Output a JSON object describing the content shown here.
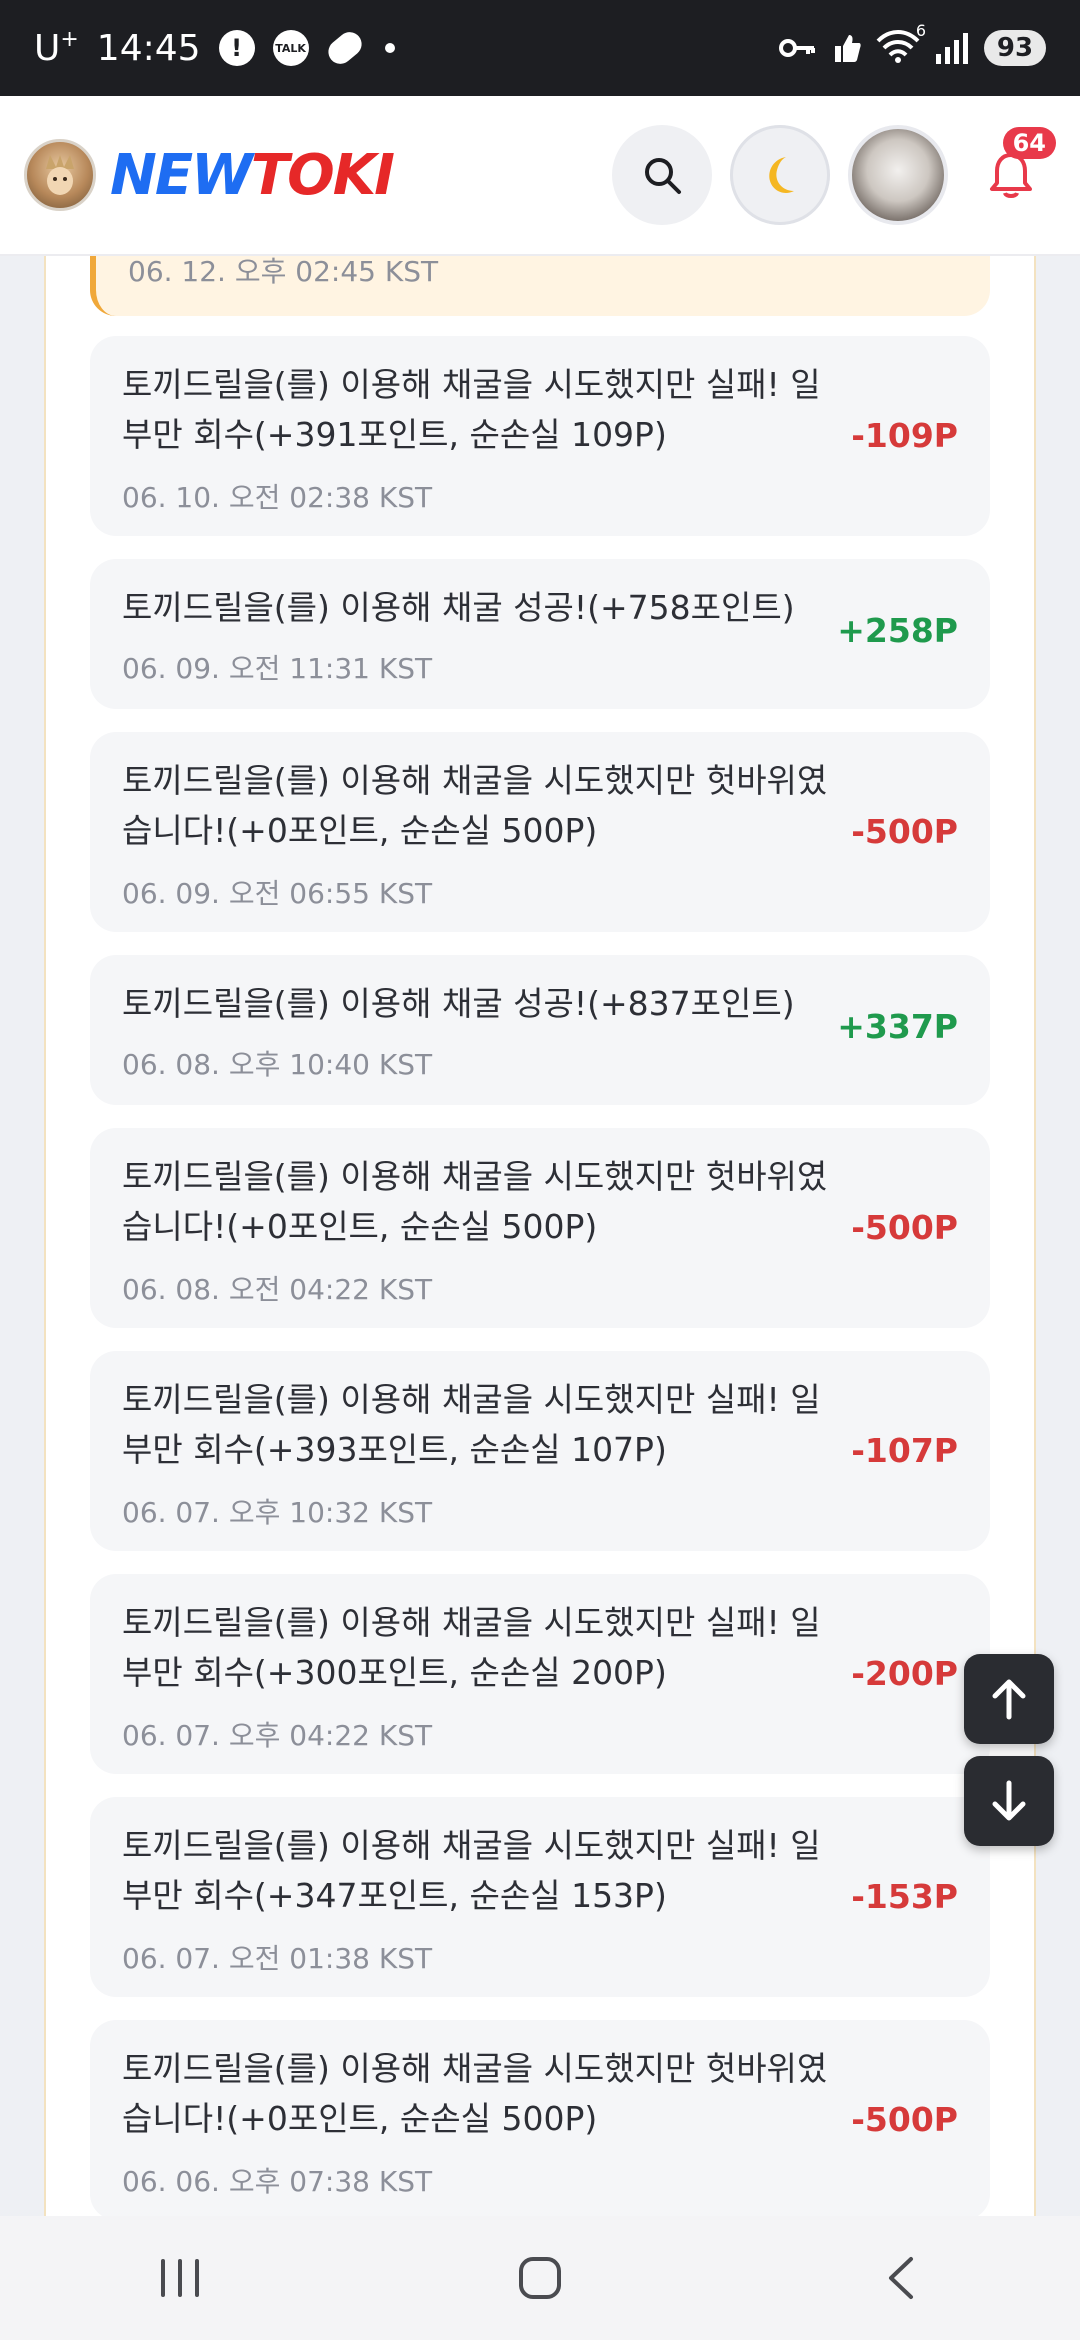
{
  "status_bar": {
    "carrier": "U",
    "carrier_sup": "+",
    "time": "14:45",
    "alert_icon": "!",
    "talk_icon": "TALK",
    "wifi_badge": "6",
    "battery": "93"
  },
  "header": {
    "logo_new": "NEW",
    "logo_toki": "TOKI",
    "notification_count": "64"
  },
  "items": [
    {
      "msg": "",
      "date": "06. 12. 오후 02:45 KST",
      "points": "",
      "kind": "pos"
    },
    {
      "msg": "토끼드릴을(를) 이용해 채굴을 시도했지만 실패! 일부만 회수(+391포인트, 순손실 109P)",
      "date": "06. 10. 오전 02:38 KST",
      "points": "-109P",
      "kind": "neg"
    },
    {
      "msg": "토끼드릴을(를) 이용해 채굴 성공!(+758포인트)",
      "date": "06. 09. 오전 11:31 KST",
      "points": "+258P",
      "kind": "pos"
    },
    {
      "msg": "토끼드릴을(를) 이용해 채굴을 시도했지만 헛바위였습니다!(+0포인트, 순손실 500P)",
      "date": "06. 09. 오전 06:55 KST",
      "points": "-500P",
      "kind": "neg"
    },
    {
      "msg": "토끼드릴을(를) 이용해 채굴 성공!(+837포인트)",
      "date": "06. 08. 오후 10:40 KST",
      "points": "+337P",
      "kind": "pos"
    },
    {
      "msg": "토끼드릴을(를) 이용해 채굴을 시도했지만 헛바위였습니다!(+0포인트, 순손실 500P)",
      "date": "06. 08. 오전 04:22 KST",
      "points": "-500P",
      "kind": "neg"
    },
    {
      "msg": "토끼드릴을(를) 이용해 채굴을 시도했지만 실패! 일부만 회수(+393포인트, 순손실 107P)",
      "date": "06. 07. 오후 10:32 KST",
      "points": "-107P",
      "kind": "neg"
    },
    {
      "msg": "토끼드릴을(를) 이용해 채굴을 시도했지만 실패! 일부만 회수(+300포인트, 순손실 200P)",
      "date": "06. 07. 오후 04:22 KST",
      "points": "-200P",
      "kind": "neg"
    },
    {
      "msg": "토끼드릴을(를) 이용해 채굴을 시도했지만 실패! 일부만 회수(+347포인트, 순손실 153P)",
      "date": "06. 07. 오전 01:38 KST",
      "points": "-153P",
      "kind": "neg"
    },
    {
      "msg": "토끼드릴을(를) 이용해 채굴을 시도했지만 헛바위였습니다!(+0포인트, 순손실 500P)",
      "date": "06. 06. 오후 07:38 KST",
      "points": "-500P",
      "kind": "neg"
    }
  ],
  "icons": {
    "search": "search-icon",
    "moon": "moon-icon",
    "bell": "bell-icon",
    "scroll_up": "arrow-up-icon",
    "scroll_down": "arrow-down-icon",
    "nav_recents": "recents-icon",
    "nav_home": "home-icon",
    "nav_back": "back-icon"
  },
  "colors": {
    "negative": "#d63a3a",
    "positive": "#1f9a4d",
    "brand_blue": "#1e6df2",
    "brand_red": "#e62828",
    "badge_red": "#e8394a"
  }
}
